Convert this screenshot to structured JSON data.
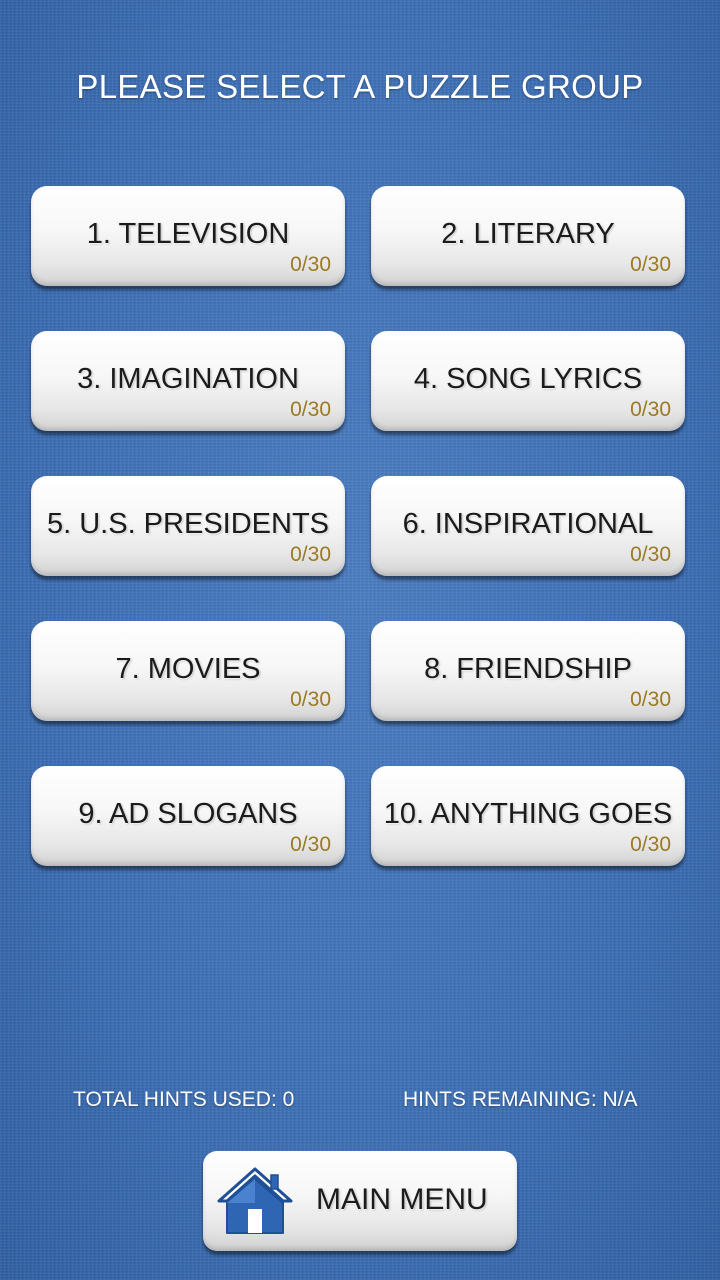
{
  "header": {
    "title": "PLEASE SELECT A PUZZLE GROUP"
  },
  "groups": [
    {
      "label": "1. TELEVISION",
      "progress": "0/30"
    },
    {
      "label": "2. LITERARY",
      "progress": "0/30"
    },
    {
      "label": "3. IMAGINATION",
      "progress": "0/30"
    },
    {
      "label": "4. SONG LYRICS",
      "progress": "0/30"
    },
    {
      "label": "5. U.S. PRESIDENTS",
      "progress": "0/30"
    },
    {
      "label": "6. INSPIRATIONAL",
      "progress": "0/30"
    },
    {
      "label": "7. MOVIES",
      "progress": "0/30"
    },
    {
      "label": "8. FRIENDSHIP",
      "progress": "0/30"
    },
    {
      "label": "9. AD SLOGANS",
      "progress": "0/30"
    },
    {
      "label": "10. ANYTHING GOES",
      "progress": "0/30"
    }
  ],
  "stats": {
    "hints_used": "TOTAL HINTS USED:  0",
    "hints_remaining": "HINTS REMAINING:  N/A"
  },
  "footer": {
    "main_menu_label": "MAIN MENU",
    "main_menu_icon": "home-icon"
  },
  "colors": {
    "background": "#3c6fb6",
    "progress_text": "#9a7a22",
    "icon_blue": "#2f66b3"
  }
}
